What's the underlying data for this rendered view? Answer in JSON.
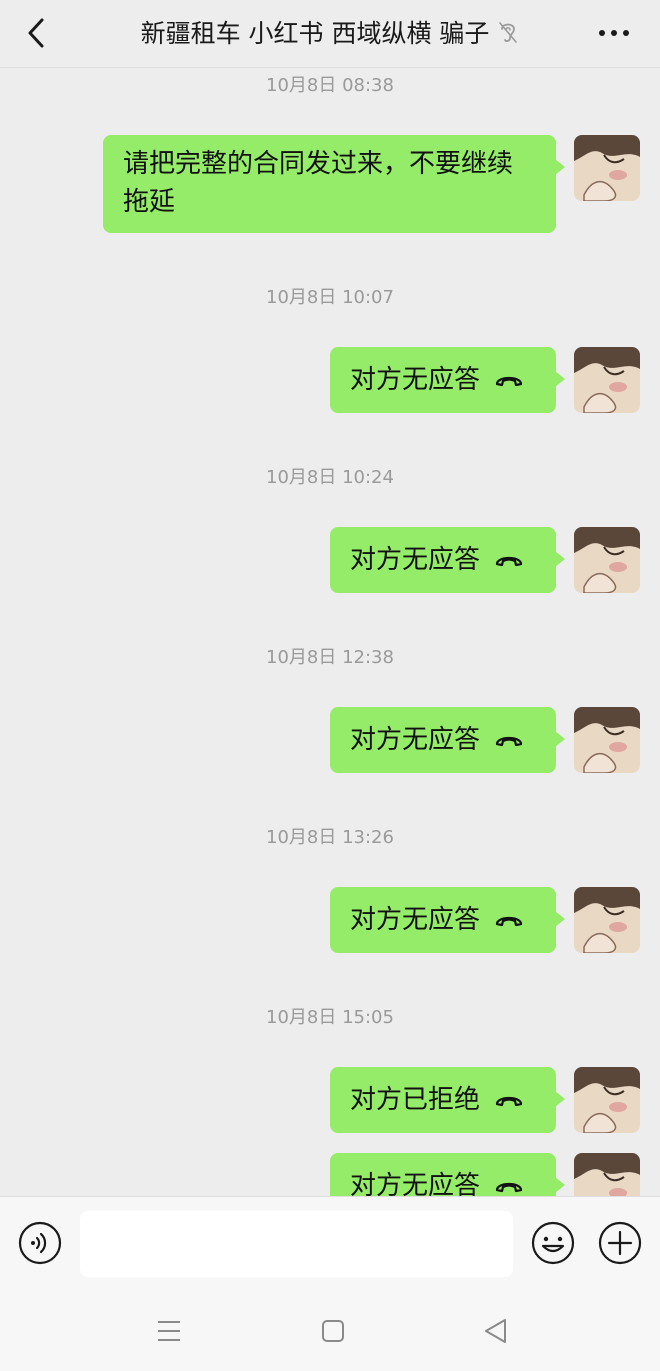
{
  "header": {
    "title": "新疆租车 小红书 西域纵横 骗子",
    "back_icon": "chevron-left-icon",
    "ear_icon": "ear-icon",
    "more_icon": "more-dots-icon"
  },
  "messages": [
    {
      "time": "10月8日 08:38",
      "type": "text",
      "text": "请把完整的合同发过来，不要继续拖延"
    },
    {
      "time": "10月8日 10:07",
      "type": "call",
      "text": "对方无应答"
    },
    {
      "time": "10月8日 10:24",
      "type": "call",
      "text": "对方无应答"
    },
    {
      "time": "10月8日 12:38",
      "type": "call",
      "text": "对方无应答"
    },
    {
      "time": "10月8日 13:26",
      "type": "call",
      "text": "对方无应答"
    },
    {
      "time": "10月8日 15:05",
      "type": "call",
      "text": "对方已拒绝"
    },
    {
      "time": "",
      "type": "call",
      "text": "对方无应答"
    }
  ],
  "input": {
    "placeholder": "",
    "voice_icon": "voice-icon",
    "emoji_icon": "emoji-icon",
    "plus_icon": "plus-icon"
  },
  "colors": {
    "bubble": "#95ec69",
    "background": "#ededed",
    "timestamp": "#9a9a9a"
  }
}
